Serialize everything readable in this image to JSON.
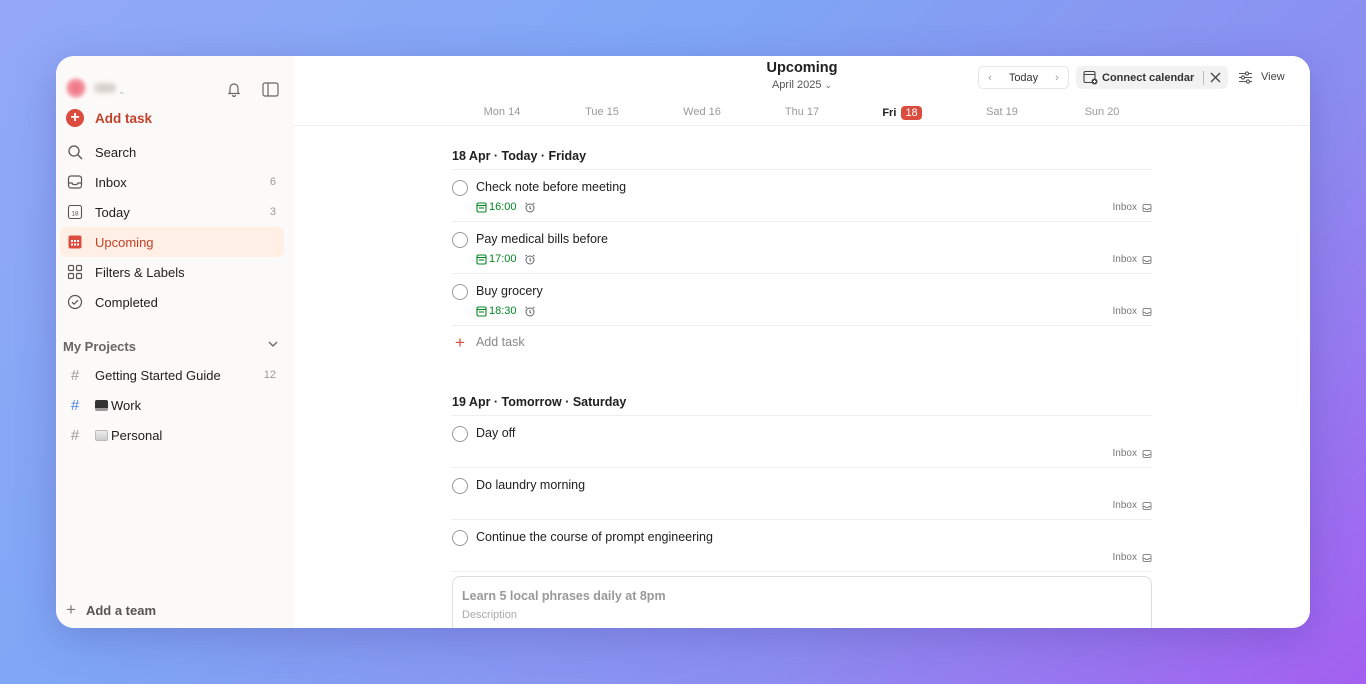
{
  "sidebar": {
    "user_badge": "⌄",
    "add_task_label": "Add task",
    "nav": [
      {
        "label": "Search",
        "count": ""
      },
      {
        "label": "Inbox",
        "count": "6"
      },
      {
        "label": "Today",
        "count": "3"
      },
      {
        "label": "Upcoming",
        "count": ""
      },
      {
        "label": "Filters & Labels",
        "count": ""
      },
      {
        "label": "Completed",
        "count": ""
      }
    ],
    "today_icon_num": "18",
    "projects_header": "My Projects",
    "projects": [
      {
        "label": "Getting Started Guide",
        "count": "12"
      },
      {
        "label": "Work",
        "count": ""
      },
      {
        "label": "Personal",
        "count": ""
      }
    ],
    "add_team_label": "Add a team"
  },
  "header": {
    "title": "Upcoming",
    "subtitle": "April 2025",
    "today_button": "Today",
    "connect_calendar": "Connect calendar",
    "view_label": "View"
  },
  "days": [
    {
      "label": "Mon 14"
    },
    {
      "label": "Tue 15"
    },
    {
      "label": "Wed 16"
    },
    {
      "label": "Thu 17"
    },
    {
      "label": "Fri",
      "badge": "18"
    },
    {
      "label": "Sat 19"
    },
    {
      "label": "Sun 20"
    }
  ],
  "sections": [
    {
      "heading": "18 Apr · Today · Friday",
      "tasks": [
        {
          "name": "Check note before meeting",
          "time": "16:00",
          "project": "Inbox"
        },
        {
          "name": "Pay medical bills before",
          "time": "17:00",
          "project": "Inbox"
        },
        {
          "name": "Buy grocery",
          "time": "18:30",
          "project": "Inbox"
        }
      ],
      "add_task": "Add task"
    },
    {
      "heading": "19 Apr · Tomorrow · Saturday",
      "tasks": [
        {
          "name": "Day off",
          "project": "Inbox"
        },
        {
          "name": "Do laundry morning",
          "project": "Inbox"
        },
        {
          "name": "Continue the course of prompt engineering",
          "project": "Inbox"
        }
      ]
    }
  ],
  "editor": {
    "title_placeholder": "Learn 5 local phrases daily at 8pm",
    "description_placeholder": "Description"
  },
  "colors": {
    "accent": "#dc4c3e",
    "active_bg": "#ffefe5",
    "time_green": "#058527"
  }
}
